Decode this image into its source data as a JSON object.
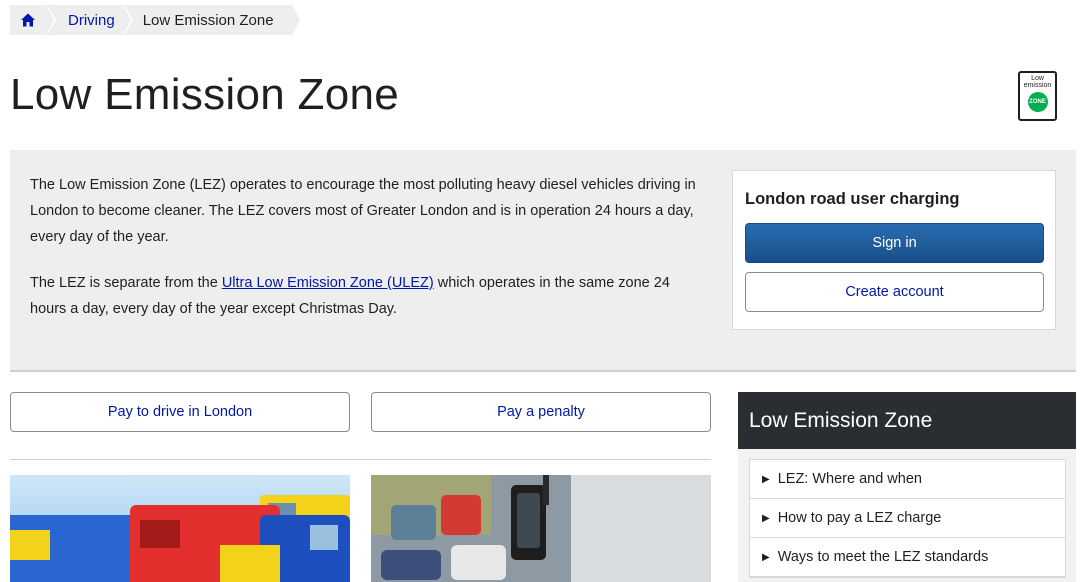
{
  "breadcrumb": {
    "home_icon": "home-icon",
    "items": [
      "Driving",
      "Low Emission Zone"
    ]
  },
  "page": {
    "title": "Low Emission Zone",
    "sign_icon": "low-emission-zone-sign-icon",
    "sign_text": "Low emission",
    "sign_zone": "ZONE"
  },
  "intro": {
    "para1": "The Low Emission Zone (LEZ) operates to encourage the most polluting heavy diesel vehicles driving in London to become cleaner. The LEZ covers most of Greater London and is in operation 24 hours a day, every day of the year.",
    "para2_before": "The LEZ is separate from the ",
    "para2_link": "Ultra Low Emission Zone (ULEZ)",
    "para2_after": " which operates in the same zone 24 hours a day, every day of the year except Christmas Day."
  },
  "ruc": {
    "title": "London road user charging",
    "sign_in": "Sign in",
    "create_account": "Create account"
  },
  "actions": {
    "pay_drive": "Pay to drive in London",
    "pay_penalty": "Pay a penalty"
  },
  "sidebar": {
    "title": "Low Emission Zone",
    "items": [
      "LEZ: Where and when",
      "How to pay a LEZ charge",
      "Ways to meet the LEZ standards"
    ]
  },
  "colors": {
    "link": "#0019a8",
    "primary_button": "#1f5b9a",
    "sidebar_header": "#2a2e33",
    "band": "#eeeeee",
    "zone_green": "#00b050"
  }
}
